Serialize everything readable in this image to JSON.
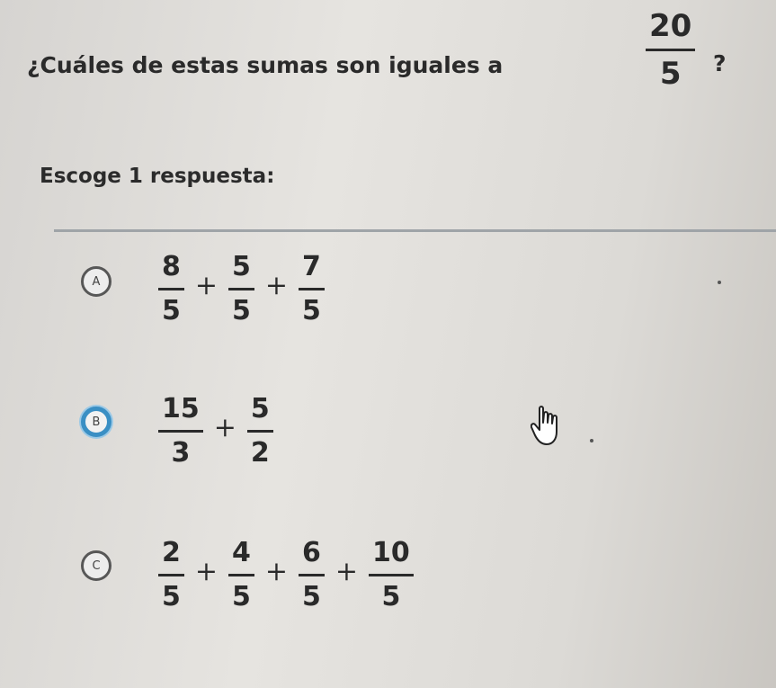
{
  "question": {
    "text": "¿Cuáles de estas sumas son iguales a",
    "fraction": {
      "num": "20",
      "den": "5"
    },
    "end_mark": "?"
  },
  "instruction": "Escoge 1 respuesta:",
  "options": [
    {
      "letter": "A",
      "selected": false,
      "fractions": [
        {
          "num": "8",
          "den": "5"
        },
        {
          "num": "5",
          "den": "5"
        },
        {
          "num": "7",
          "den": "5"
        }
      ],
      "operator": "+"
    },
    {
      "letter": "B",
      "selected": true,
      "fractions": [
        {
          "num": "15",
          "den": "3"
        },
        {
          "num": "5",
          "den": "2"
        }
      ],
      "operator": "+"
    },
    {
      "letter": "C",
      "selected": false,
      "fractions": [
        {
          "num": "2",
          "den": "5"
        },
        {
          "num": "4",
          "den": "5"
        },
        {
          "num": "6",
          "den": "5"
        },
        {
          "num": "10",
          "den": "5"
        }
      ],
      "operator": "+"
    }
  ],
  "icons": {
    "cursor": "hand-pointer-icon"
  },
  "colors": {
    "selected_ring": "#3a8fc4",
    "divider": "#9fa4a8"
  }
}
